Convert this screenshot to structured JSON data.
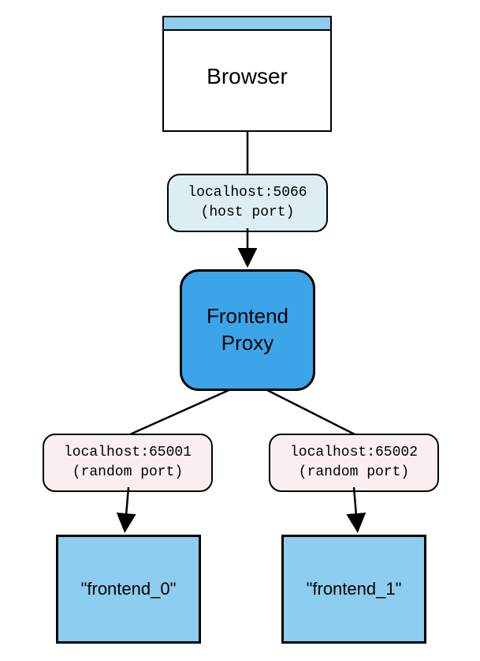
{
  "browser": {
    "label": "Browser"
  },
  "proxy": {
    "label": "Frontend\nProxy"
  },
  "hostPort": {
    "line1": "localhost:5066",
    "line2": "(host port)"
  },
  "leftPort": {
    "line1": "localhost:65001",
    "line2": "(random port)"
  },
  "rightPort": {
    "line1": "localhost:65002",
    "line2": "(random port)"
  },
  "instances": {
    "left": "\"frontend_0\"",
    "right": "\"frontend_1\""
  }
}
